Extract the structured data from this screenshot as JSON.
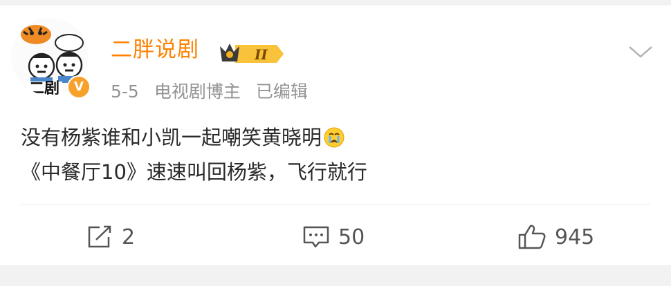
{
  "post": {
    "author": {
      "name": "二胖说剧",
      "rank_badge": "II",
      "avatar_label": "二剧",
      "verified_mark": "V"
    },
    "meta": {
      "date": "5-5",
      "role": "电视剧博主",
      "edited": "已编辑"
    },
    "content": {
      "line1": "没有杨紫谁和小凯一起嘲笑黄晓明",
      "line1_emoji": "crying-face-icon",
      "line2": "《中餐厅10》速速叫回杨紫，飞行就行"
    },
    "actions": {
      "repost_count": "2",
      "comment_count": "50",
      "like_count": "945"
    }
  },
  "colors": {
    "username": "#ff8200",
    "meta": "#939393",
    "text": "#2a2a2a",
    "background": "#f2f2f2",
    "badge_gold": "#f5b21b"
  }
}
